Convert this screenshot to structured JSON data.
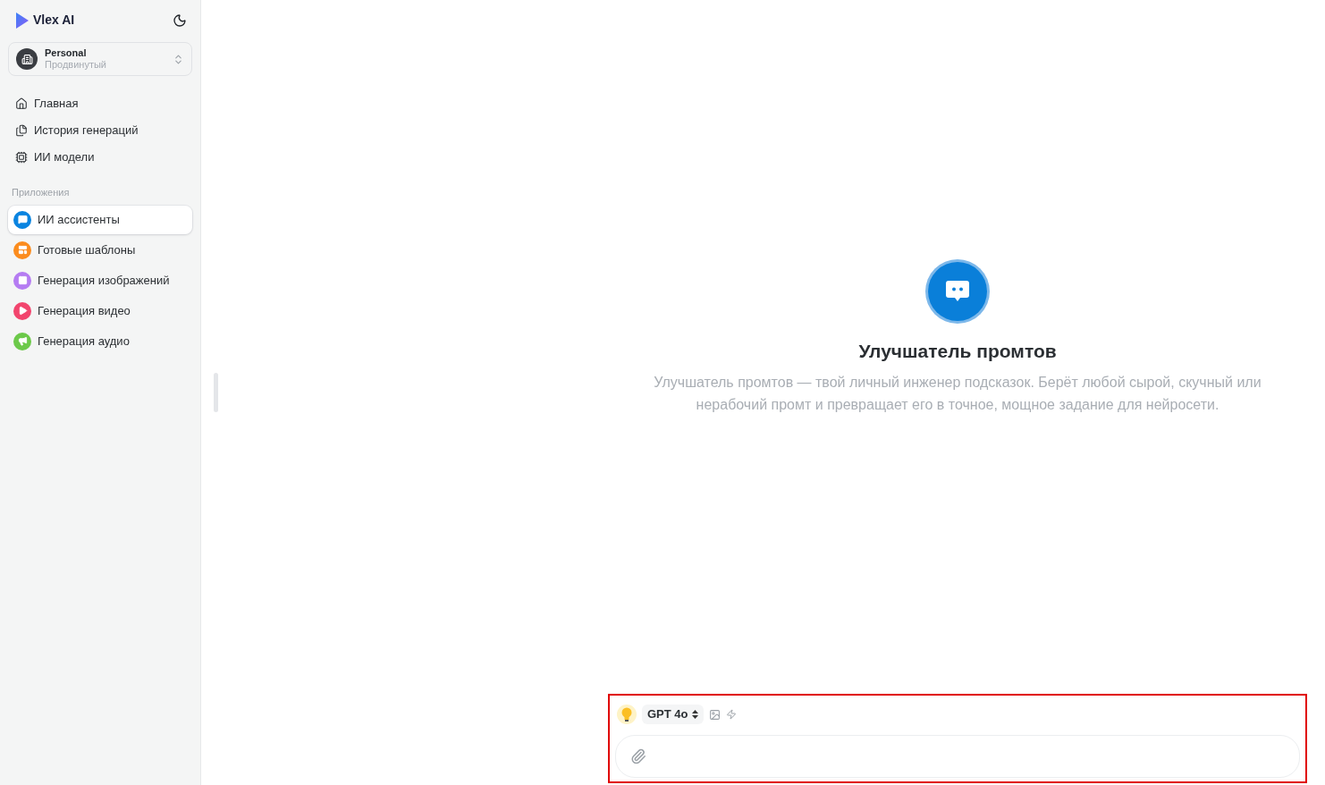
{
  "brand": {
    "name": "Vlex AI"
  },
  "workspace": {
    "name": "Personal",
    "plan": "Продвинутый"
  },
  "nav": [
    {
      "label": "Главная"
    },
    {
      "label": "История генераций"
    },
    {
      "label": "ИИ модели"
    }
  ],
  "apps_section": {
    "title": "Приложения",
    "items": [
      {
        "label": "ИИ ассистенты",
        "color": "#0a84e0",
        "selected": true
      },
      {
        "label": "Готовые шаблоны",
        "color": "#fb8c1e",
        "selected": false
      },
      {
        "label": "Генерация изображений",
        "color": "#b57cf2",
        "selected": false
      },
      {
        "label": "Генерация видео",
        "color": "#f2456e",
        "selected": false
      },
      {
        "label": "Генерация аудио",
        "color": "#6cc94a",
        "selected": false
      }
    ]
  },
  "assistant": {
    "title": "Улучшатель промтов",
    "description": "Улучшатель промтов — твой личный инженер подсказок. Берёт любой сырой, скучный или нерабочий промт и превращает его в точное, мощное задание для нейросети."
  },
  "composer": {
    "highlighted": true,
    "model": "GPT 4o"
  }
}
